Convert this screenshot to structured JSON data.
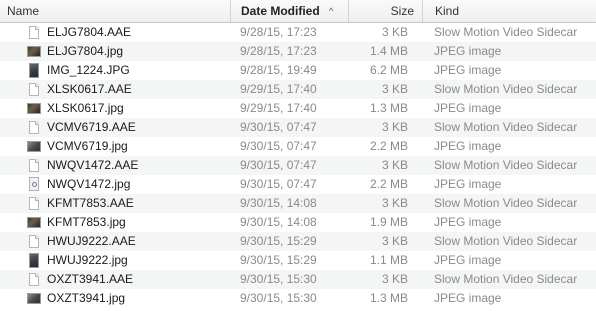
{
  "columns": {
    "name": "Name",
    "date_modified": "Date Modified",
    "size": "Size",
    "kind": "Kind",
    "sort_indicator": "^"
  },
  "files": [
    {
      "name": "ELJG7804.AAE",
      "date": "9/28/15, 17:23",
      "size": "3 KB",
      "kind": "Slow Motion Video Sidecar",
      "icon": "document-icon"
    },
    {
      "name": "ELJG7804.jpg",
      "date": "9/28/15, 17:23",
      "size": "1.4 MB",
      "kind": "JPEG image",
      "icon": "image-thumbnail-icon"
    },
    {
      "name": "IMG_1224.JPG",
      "date": "9/28/15, 19:49",
      "size": "6.2 MB",
      "kind": "JPEG image",
      "icon": "image-thumbnail-icon"
    },
    {
      "name": "XLSK0617.AAE",
      "date": "9/29/15, 17:40",
      "size": "3 KB",
      "kind": "Slow Motion Video Sidecar",
      "icon": "document-icon"
    },
    {
      "name": "XLSK0617.jpg",
      "date": "9/29/15, 17:40",
      "size": "1.3 MB",
      "kind": "JPEG image",
      "icon": "image-thumbnail-icon"
    },
    {
      "name": "VCMV6719.AAE",
      "date": "9/30/15, 07:47",
      "size": "3 KB",
      "kind": "Slow Motion Video Sidecar",
      "icon": "document-icon"
    },
    {
      "name": "VCMV6719.jpg",
      "date": "9/30/15, 07:47",
      "size": "2.2 MB",
      "kind": "JPEG image",
      "icon": "image-thumbnail-icon"
    },
    {
      "name": "NWQV1472.AAE",
      "date": "9/30/15, 07:47",
      "size": "3 KB",
      "kind": "Slow Motion Video Sidecar",
      "icon": "document-icon"
    },
    {
      "name": "NWQV1472.jpg",
      "date": "9/30/15, 07:47",
      "size": "2.2 MB",
      "kind": "JPEG image",
      "icon": "image-thumbnail-icon"
    },
    {
      "name": "KFMT7853.AAE",
      "date": "9/30/15, 14:08",
      "size": "3 KB",
      "kind": "Slow Motion Video Sidecar",
      "icon": "document-icon"
    },
    {
      "name": "KFMT7853.jpg",
      "date": "9/30/15, 14:08",
      "size": "1.9 MB",
      "kind": "JPEG image",
      "icon": "image-thumbnail-icon"
    },
    {
      "name": "HWUJ9222.AAE",
      "date": "9/30/15, 15:29",
      "size": "3 KB",
      "kind": "Slow Motion Video Sidecar",
      "icon": "document-icon"
    },
    {
      "name": "HWUJ9222.jpg",
      "date": "9/30/15, 15:29",
      "size": "1.1 MB",
      "kind": "JPEG image",
      "icon": "image-thumbnail-icon"
    },
    {
      "name": "OXZT3941.AAE",
      "date": "9/30/15, 15:30",
      "size": "3 KB",
      "kind": "Slow Motion Video Sidecar",
      "icon": "document-icon"
    },
    {
      "name": "OXZT3941.jpg",
      "date": "9/30/15, 15:30",
      "size": "1.3 MB",
      "kind": "JPEG image",
      "icon": "image-thumbnail-icon"
    }
  ]
}
